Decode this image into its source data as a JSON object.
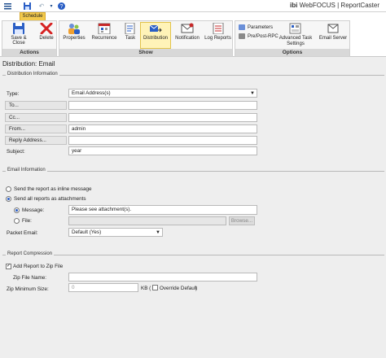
{
  "app": {
    "title_prefix": "WebFOCUS",
    "title_suffix": "ReportCaster",
    "logo": "ibi"
  },
  "quick_access": {
    "save_icon": "save-icon",
    "undo_icon": "undo-icon",
    "help_icon": "help-icon"
  },
  "tabs": [
    {
      "label": "Schedule"
    }
  ],
  "ribbon": {
    "groups": {
      "actions": "Actions",
      "show": "Show",
      "options": "Options"
    },
    "actions": [
      {
        "label": "Save & Close",
        "icon": "floppy-icon"
      },
      {
        "label": "Delete",
        "icon": "delete-x-icon"
      }
    ],
    "show": [
      {
        "label": "Properties",
        "icon": "properties-icon"
      },
      {
        "label": "Recurrence",
        "icon": "calendar-icon"
      },
      {
        "label": "Task",
        "icon": "task-icon"
      },
      {
        "label": "Distribution",
        "icon": "distribution-icon",
        "active": true
      },
      {
        "label": "Notification",
        "icon": "envelope-icon"
      },
      {
        "label": "Log Reports",
        "icon": "log-icon"
      }
    ],
    "options_small": [
      {
        "label": "Parameters",
        "icon": "parameters-icon"
      },
      {
        "label": "Pre/Post-RPC",
        "icon": "rpc-icon"
      }
    ],
    "options_large": [
      {
        "label": "Advanced Task\nSettings",
        "icon": "advanced-settings-icon"
      },
      {
        "label": "Email Server",
        "icon": "email-server-icon"
      }
    ]
  },
  "page_title": "Distribution: Email",
  "distribution_info": {
    "section_title": "Distribution Information",
    "type_label": "Type:",
    "type_value": "Email Address(s)",
    "to_button": "To...",
    "to_value": "",
    "cc_button": "Cc...",
    "cc_value": "",
    "from_button": "From...",
    "from_value": "admin",
    "reply_button": "Reply Address...",
    "reply_value": "",
    "subject_label": "Subject:",
    "subject_value": "year"
  },
  "email_info": {
    "section_title": "Email Information",
    "inline_option": "Send the report as inline message",
    "attach_option": "Send all reports as attachments",
    "message_label": "Message:",
    "message_value": "Please see attachment(s).",
    "file_label": "File:",
    "file_value": "",
    "browse_button": "Browse...",
    "packet_label": "Packet Email:",
    "packet_value": "Default (Yes)"
  },
  "report_compression": {
    "section_title": "Report Compression",
    "add_zip_label": "Add Report to Zip File",
    "zip_name_label": "Zip File Name:",
    "zip_name_value": "",
    "zip_min_label": "Zip Minimum Size:",
    "zip_min_value": "0",
    "kb_label": "KB (",
    "override_label": "Override Default",
    "close_paren": ")"
  }
}
